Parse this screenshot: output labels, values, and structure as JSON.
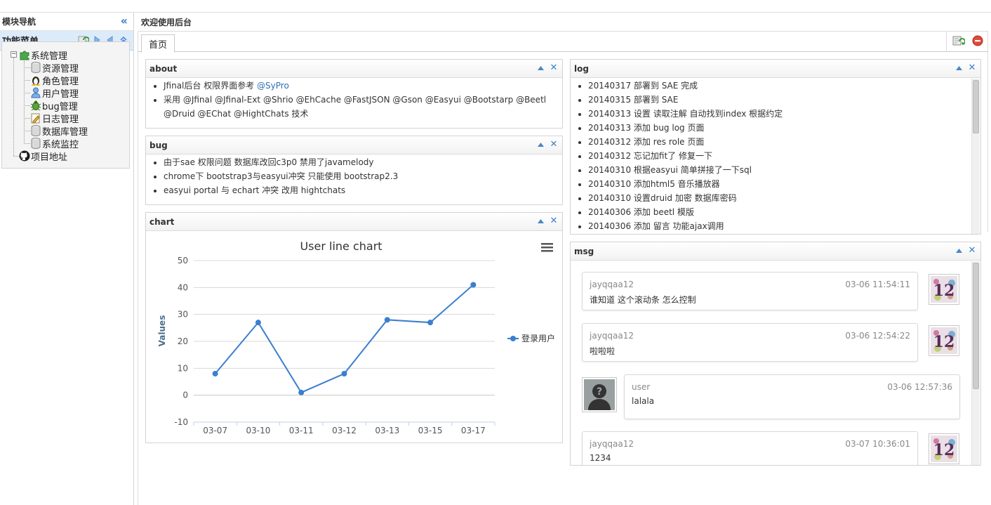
{
  "west": {
    "title": "模块导航",
    "menu_title": "功能菜单",
    "tree": {
      "root_label": "系统管理",
      "children": [
        {
          "label": "资源管理",
          "icon": "database-icon"
        },
        {
          "label": "角色管理",
          "icon": "linux-penguin-icon"
        },
        {
          "label": "用户管理",
          "icon": "user-icon"
        },
        {
          "label": "bug管理",
          "icon": "bug-icon"
        },
        {
          "label": "日志管理",
          "icon": "edit-log-icon"
        },
        {
          "label": "数据库管理",
          "icon": "database-icon"
        },
        {
          "label": "系统监控",
          "icon": "database-icon"
        }
      ],
      "project_label": "项目地址"
    }
  },
  "center": {
    "title": "欢迎使用后台",
    "tabs": [
      {
        "label": "首页"
      }
    ]
  },
  "portal": {
    "about": {
      "title": "about",
      "line1_text": "Jfinal后台 权限界面参考 ",
      "line1_link": "@SyPro",
      "line2_a": "采用 @Jfinal @Jfinal-Ext @Shrio @EhCache @FastJSON @Gson @Easyui @Bootstarp @Beetl",
      "line2_b": "@Druid @EChat @HightChats 技术"
    },
    "bug": {
      "title": "bug",
      "items": [
        "由于sae 权限问题 数据库改回c3p0 禁用了javamelody",
        "chrome下 bootstrap3与easyui冲突 只能使用 bootstrap2.3",
        "easyui portal 与 echart 冲突 改用 hightchats"
      ]
    },
    "log": {
      "title": "log",
      "items": [
        "20140317 部署到 SAE 完成",
        "20140315 部署到 SAE",
        "20140313 设置 读取注解 自动找到index 根据约定",
        "20140313 添加 bug log 页面",
        "20140312 添加 res role 页面",
        "20140312 忘记加fit了 修复一下",
        "20140310 根据easyui 简单拼接了一下sql",
        "20140310 添加html5 音乐播放器",
        "20140310 设置druid 加密 数据库密码",
        "20140306 添加 beetl 模版",
        "20140306 添加 留言 功能ajax调用"
      ]
    },
    "chart": {
      "title": "chart"
    },
    "msg": {
      "title": "msg",
      "items": [
        {
          "user": "jayqqaa12",
          "time": "03-06 11:54:11",
          "text": "谁知道 这个滚动条 怎么控制",
          "side": "left"
        },
        {
          "user": "jayqqaa12",
          "time": "03-06 12:54:22",
          "text": "啦啦啦",
          "side": "left"
        },
        {
          "user": "user",
          "time": "03-06 12:57:36",
          "text": "lalala",
          "side": "right"
        },
        {
          "user": "jayqqaa12",
          "time": "03-07 10:36:01",
          "text": "1234",
          "side": "left"
        }
      ],
      "avatar_text": "12"
    }
  },
  "colors": {
    "accent": "#2f78c6",
    "line": "#3a7fd0",
    "menu_header_bg": "#dcebfa"
  },
  "chart_data": {
    "type": "line",
    "title": "User line chart",
    "ylabel": "Values",
    "xlabel": "",
    "categories": [
      "03-07",
      "03-10",
      "03-11",
      "03-12",
      "03-13",
      "03-15",
      "03-17"
    ],
    "series": [
      {
        "name": "登录用户",
        "values": [
          8,
          27,
          1,
          8,
          28,
          27,
          41
        ]
      }
    ],
    "ylim": [
      -10,
      50
    ],
    "yticks": [
      -10,
      0,
      10,
      20,
      30,
      40,
      50
    ],
    "grid": true,
    "legend": "right"
  }
}
